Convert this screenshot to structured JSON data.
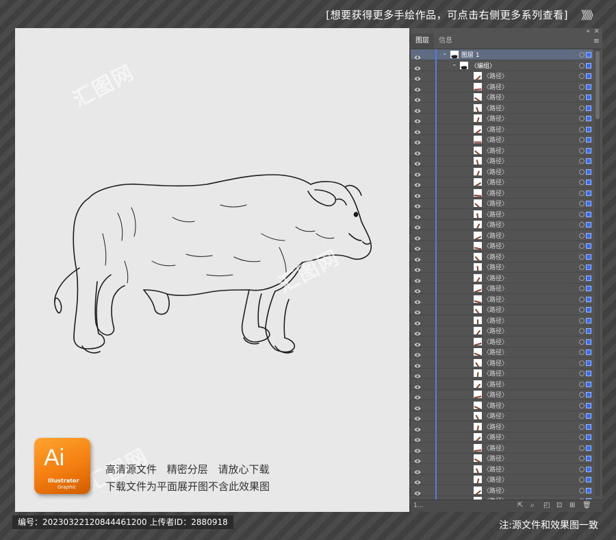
{
  "banner": {
    "text": "[想要获得更多手绘作品，可点击右侧更多系列查看]",
    "arrows": "》》》"
  },
  "promo": {
    "icon_text": "Ai",
    "icon_sub1": "Illustrator",
    "icon_sub2": "Graphic",
    "line1": "高清源文件 精密分层 请放心下载",
    "line2": "下载文件为平面展开图不含此效果图"
  },
  "watermark": {
    "text": "汇图网"
  },
  "panel": {
    "tabs": [
      {
        "label": "图层",
        "active": true
      },
      {
        "label": "信息",
        "active": false
      }
    ],
    "collapse_icon": "«",
    "close_icon": "×",
    "menu_icon": "≡",
    "layer_name": "图层 1",
    "group_name": "〈编组〉",
    "path_name": "〈路径〉",
    "path_count": 41,
    "footer_count": "1...",
    "footer_buttons": [
      "export-icon",
      "search-icon",
      "clip-icon",
      "sublayer-icon",
      "new-layer-icon",
      "trash-icon"
    ]
  },
  "footer": {
    "id_label": "编号：20230322120844461200   上传者ID：2880918",
    "note": "注:源文件和效果图一致"
  },
  "colors": {
    "accent": "#3b6fe8",
    "selection_bar": "#4f7fe0",
    "ai_orange": "#f47e0f"
  }
}
